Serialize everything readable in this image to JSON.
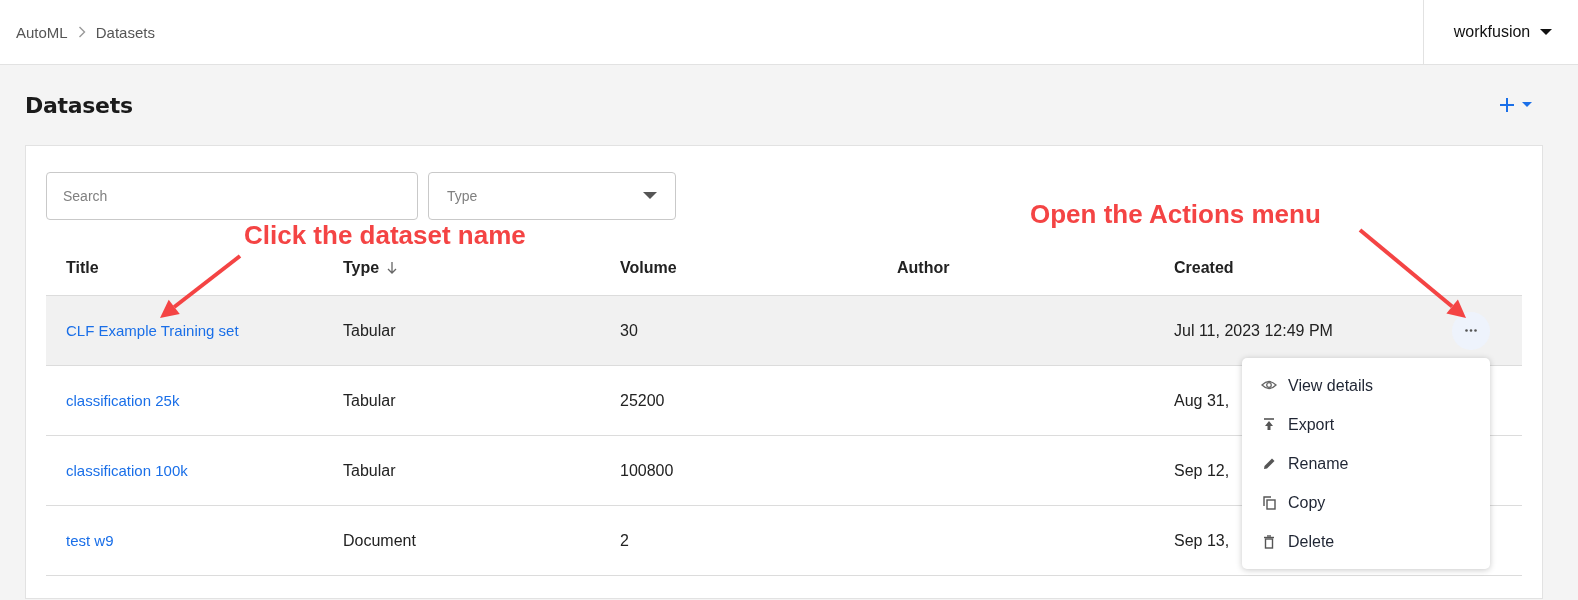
{
  "breadcrumb": [
    {
      "label": "AutoML"
    },
    {
      "label": "Datasets"
    }
  ],
  "user_menu": {
    "label": "workfusion"
  },
  "page": {
    "title": "Datasets"
  },
  "filters": {
    "search": {
      "placeholder": "Search"
    },
    "type": {
      "placeholder": "Type"
    }
  },
  "table": {
    "columns": [
      {
        "label": "Title",
        "sorted": false
      },
      {
        "label": "Type",
        "sorted": true
      },
      {
        "label": "Volume",
        "sorted": false
      },
      {
        "label": "Author",
        "sorted": false
      },
      {
        "label": "Created",
        "sorted": false
      }
    ],
    "rows": [
      {
        "title": "CLF Example Training set",
        "type": "Tabular",
        "volume": "30",
        "created": "Jul 11, 2023 12:49 PM",
        "highlighted": true
      },
      {
        "title": "classification 25k",
        "type": "Tabular",
        "volume": "25200",
        "created": "Aug 31,",
        "highlighted": false
      },
      {
        "title": "classification 100k",
        "type": "Tabular",
        "volume": "100800",
        "created": "Sep 12,",
        "highlighted": false
      },
      {
        "title": "test w9",
        "type": "Document",
        "volume": "2",
        "created": "Sep 13,",
        "highlighted": false
      }
    ]
  },
  "actions_menu": {
    "items": [
      {
        "label": "View details",
        "kind": "view"
      },
      {
        "label": "Export",
        "kind": "export"
      },
      {
        "label": "Rename",
        "kind": "rename"
      },
      {
        "label": "Copy",
        "kind": "copy"
      },
      {
        "label": "Delete",
        "kind": "delete"
      }
    ]
  },
  "annotations": [
    {
      "text": "Click the dataset name"
    },
    {
      "text": "Open the Actions menu"
    }
  ]
}
